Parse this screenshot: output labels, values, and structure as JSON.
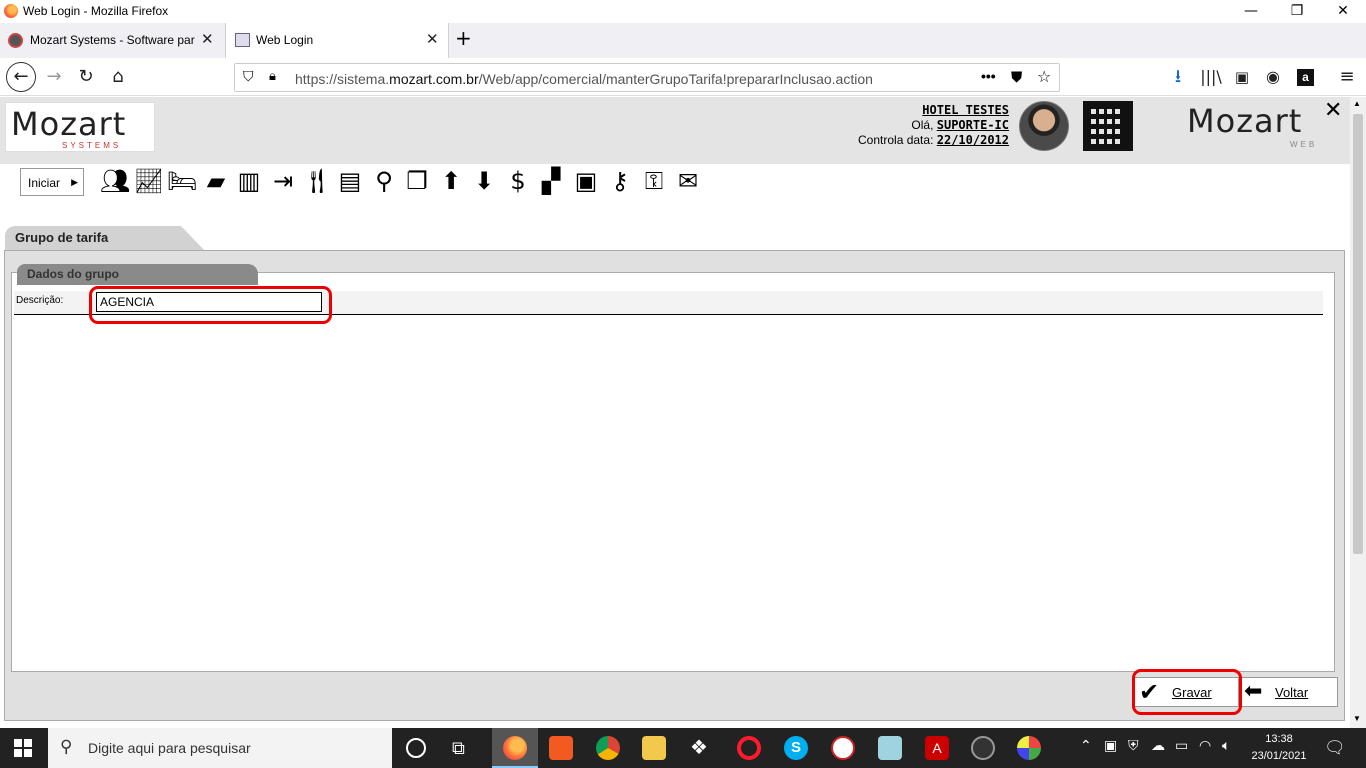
{
  "window": {
    "title": "Web Login - Mozilla Firefox",
    "minimize": "—",
    "maximize": "❐",
    "close": "✕"
  },
  "tabs": [
    {
      "label": "Mozart Systems - Software para",
      "close": "✕"
    },
    {
      "label": "Web Login",
      "close": "✕"
    }
  ],
  "newtab": "+",
  "url": {
    "prefix": "https://sistema.",
    "domain": "mozart.com.br",
    "path": "/Web/app/comercial/manterGrupoTarifa!prepararInclusao.action"
  },
  "header": {
    "hotel": "HOTEL TESTES",
    "greeting": "Olá,",
    "user": "SUPORTE-IC",
    "control_label": "Controla data:",
    "control_date": "22/10/2012",
    "logo_left": {
      "word": "Mozart",
      "sub": "SYSTEMS"
    },
    "logo_right": {
      "word": "Mozart",
      "sub": "WEB"
    }
  },
  "toolbar": {
    "start_label": "Iniciar",
    "icons": [
      "users-icon",
      "chart-icon",
      "bed-icon",
      "card-icon",
      "building-icon",
      "login-icon",
      "restaurant-icon",
      "cashier-icon",
      "search-icon",
      "windows-icon",
      "upload-icon",
      "download-icon",
      "dollar-icon",
      "boxes-icon",
      "folder-icon",
      "key-icon",
      "user-key-icon",
      "mail-icon"
    ]
  },
  "page": {
    "tab_title": "Grupo de tarifa",
    "section_title": "Dados do grupo",
    "desc_label": "Descrição:",
    "desc_value": "AGENCIA"
  },
  "buttons": {
    "save": "Gravar",
    "back": "Voltar"
  },
  "taskbar": {
    "search_placeholder": "Digite aqui para pesquisar",
    "time": "13:38",
    "date": "23/01/2021"
  },
  "colors": {
    "highlight": "#e00000",
    "panel": "#e0e0e0",
    "section_tab": "#8a8a8a"
  }
}
